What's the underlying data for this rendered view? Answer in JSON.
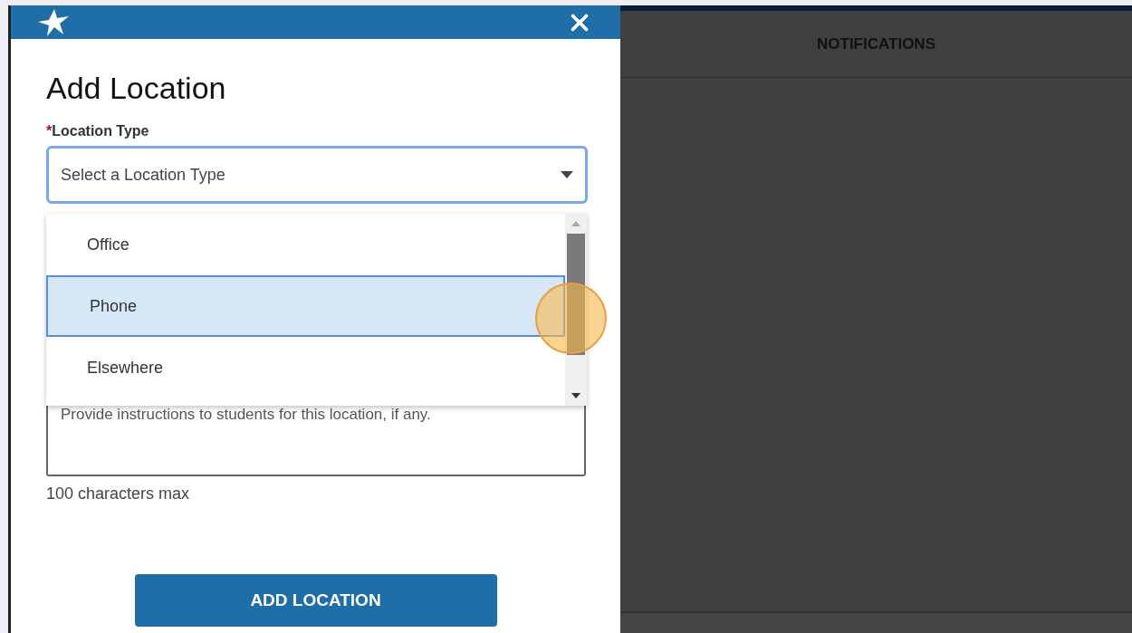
{
  "dialog": {
    "title": "Add Location",
    "field_label": "Location Type",
    "required_mark": "*",
    "select_placeholder": "Select a Location Type",
    "options": [
      {
        "label": "Office",
        "selected": false
      },
      {
        "label": "Phone",
        "selected": true
      },
      {
        "label": "Elsewhere",
        "selected": false
      }
    ],
    "instructions_placeholder": "Provide instructions to students for this location, if any.",
    "helper": "100 characters max",
    "button": "ADD LOCATION"
  },
  "panel": {
    "title": "NOTIFICATIONS"
  }
}
